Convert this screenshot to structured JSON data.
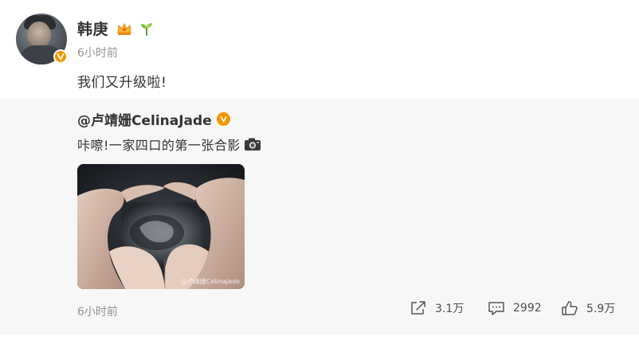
{
  "post": {
    "author": "韩庚",
    "timestamp": "6小时前",
    "text": "我们又升级啦!",
    "badges": [
      "crown-icon",
      "sprout-icon"
    ]
  },
  "repost": {
    "author": "@卢靖姗CelinaJade",
    "text": "咔嚓!一家四口的第一张合影",
    "image_watermark": "@卢靖姗CelinaJade",
    "timestamp": "6小时前",
    "actions": {
      "share_count": "3.1万",
      "comment_count": "2992",
      "like_count": "5.9万"
    }
  },
  "colors": {
    "verify_orange": "#f29700",
    "text_primary": "#333333",
    "text_muted": "#939393",
    "repost_bg": "#f7f7f7"
  }
}
